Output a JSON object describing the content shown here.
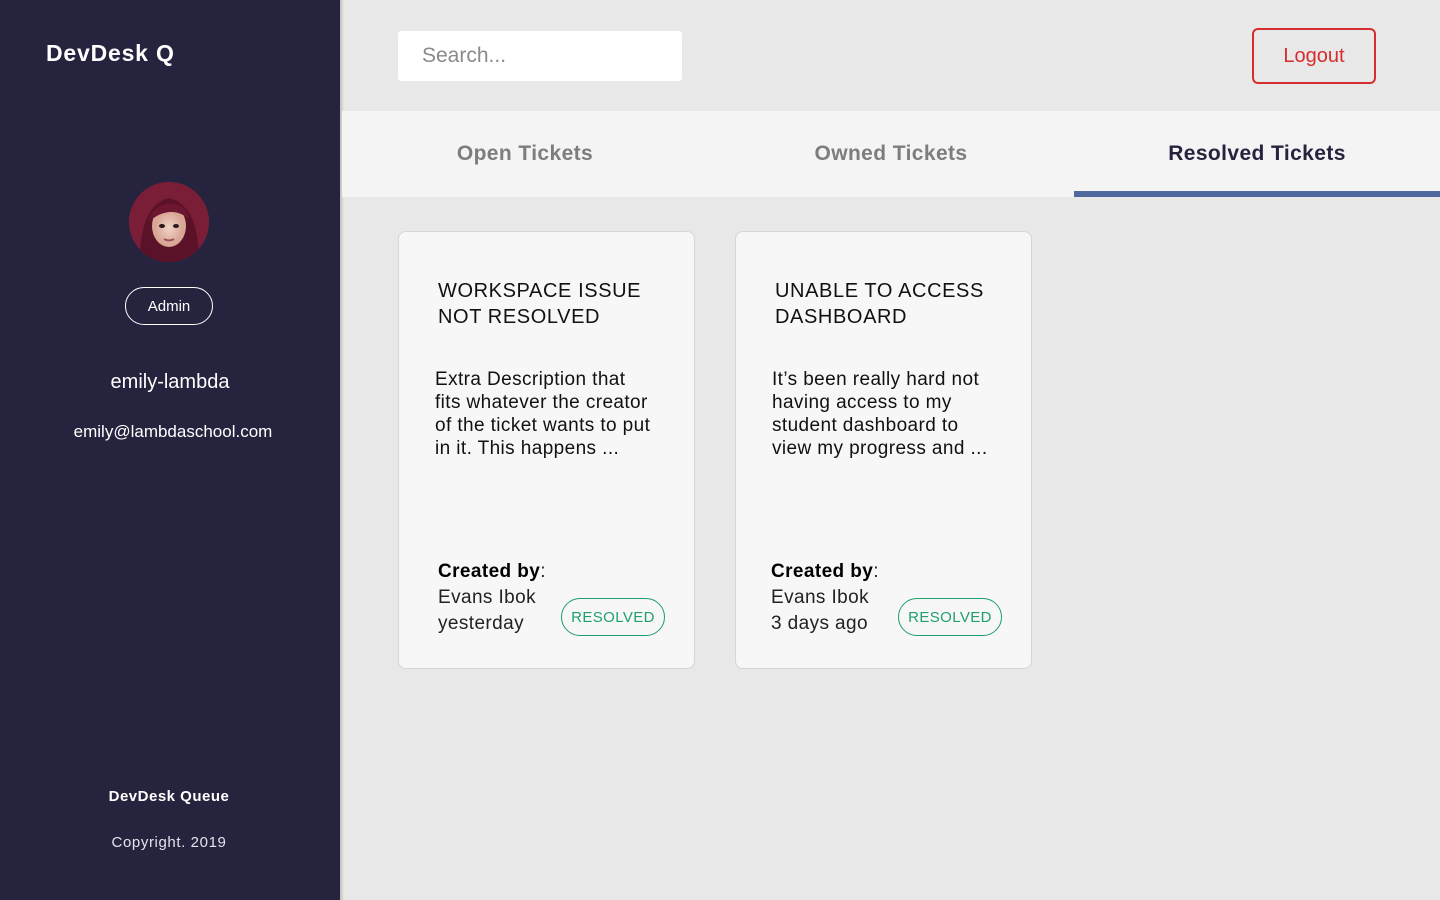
{
  "app": {
    "brand": "DevDesk Q"
  },
  "user": {
    "role": "Admin",
    "username": "emily-lambda",
    "email": "emily@lambdaschool.com"
  },
  "sidebar_footer": {
    "title": "DevDesk Queue",
    "copyright": "Copyright. 2019"
  },
  "header": {
    "search_placeholder": "Search...",
    "logout_label": "Logout"
  },
  "tabs": [
    {
      "label": "Open Tickets",
      "active": false
    },
    {
      "label": "Owned Tickets",
      "active": false
    },
    {
      "label": "Resolved Tickets",
      "active": true
    }
  ],
  "tickets": [
    {
      "title": "WORKSPACE ISSUE NOT RESOLVED",
      "description": "Extra Description that fits whatever the creator of the ticket wants to put in it. This happens ...",
      "created_by_label": "Created by",
      "creator": "Evans Ibok",
      "time": "yesterday",
      "status": "RESOLVED"
    },
    {
      "title": "UNABLE TO ACCESS DASHBOARD",
      "description": "It’s been really hard not having access to my student dashboard to view my progress and ...",
      "created_by_label": "Created by",
      "creator": "Evans Ibok",
      "time": "3 days ago",
      "status": "RESOLVED"
    }
  ],
  "colors": {
    "sidebar_bg": "#25233d",
    "accent_tab": "#4e6a9e",
    "logout": "#d62e2e",
    "resolved": "#1fa06b"
  }
}
